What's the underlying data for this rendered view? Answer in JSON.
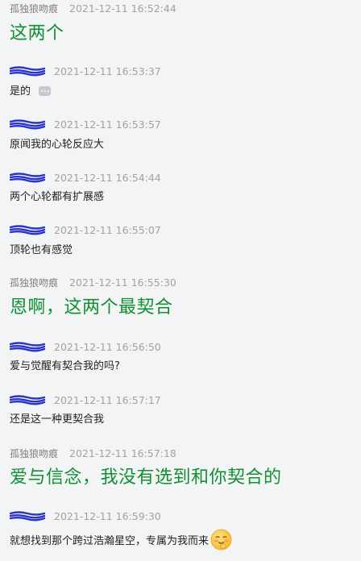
{
  "messages": [
    {
      "sender": "孤独狼吻痕",
      "time": "2021-12-11 16:52:44",
      "text": "这两个",
      "style": "large"
    },
    {
      "sender": "",
      "time": "2021-12-11 16:53:37",
      "text": "是的",
      "style": "small",
      "has_more_icon": true
    },
    {
      "sender": "",
      "time": "2021-12-11 16:53:57",
      "text": "原闻我的心轮反应大",
      "style": "small"
    },
    {
      "sender": "",
      "time": "2021-12-11 16:54:44",
      "text": "两个心轮都有扩展感",
      "style": "small"
    },
    {
      "sender": "",
      "time": "2021-12-11 16:55:07",
      "text": "顶轮也有感觉",
      "style": "small"
    },
    {
      "sender": "孤独狼吻痕",
      "time": "2021-12-11 16:55:30",
      "text": "恩啊，这两个最契合",
      "style": "large"
    },
    {
      "sender": "",
      "time": "2021-12-11 16:56:50",
      "text": "爱与觉醒有契合我的吗?",
      "style": "small"
    },
    {
      "sender": "",
      "time": "2021-12-11 16:57:17",
      "text": "还是这一种更契合我",
      "style": "small"
    },
    {
      "sender": "孤独狼吻痕",
      "time": "2021-12-11 16:57:18",
      "text": "爱与信念，我没有选到和你契合的",
      "style": "large"
    },
    {
      "sender": "",
      "time": "2021-12-11 16:59:30",
      "text": "就想找到那个跨过浩瀚星空，专属为我而来",
      "style": "small",
      "has_emoji": true
    }
  ],
  "colors": {
    "background": "#f3f4f6",
    "large_text": "#119031",
    "meta_time": "#a2a2a2",
    "redaction": "#2b34c9"
  },
  "icons": {
    "more": "more-icon",
    "emoji": "shy-smile-emoji"
  }
}
